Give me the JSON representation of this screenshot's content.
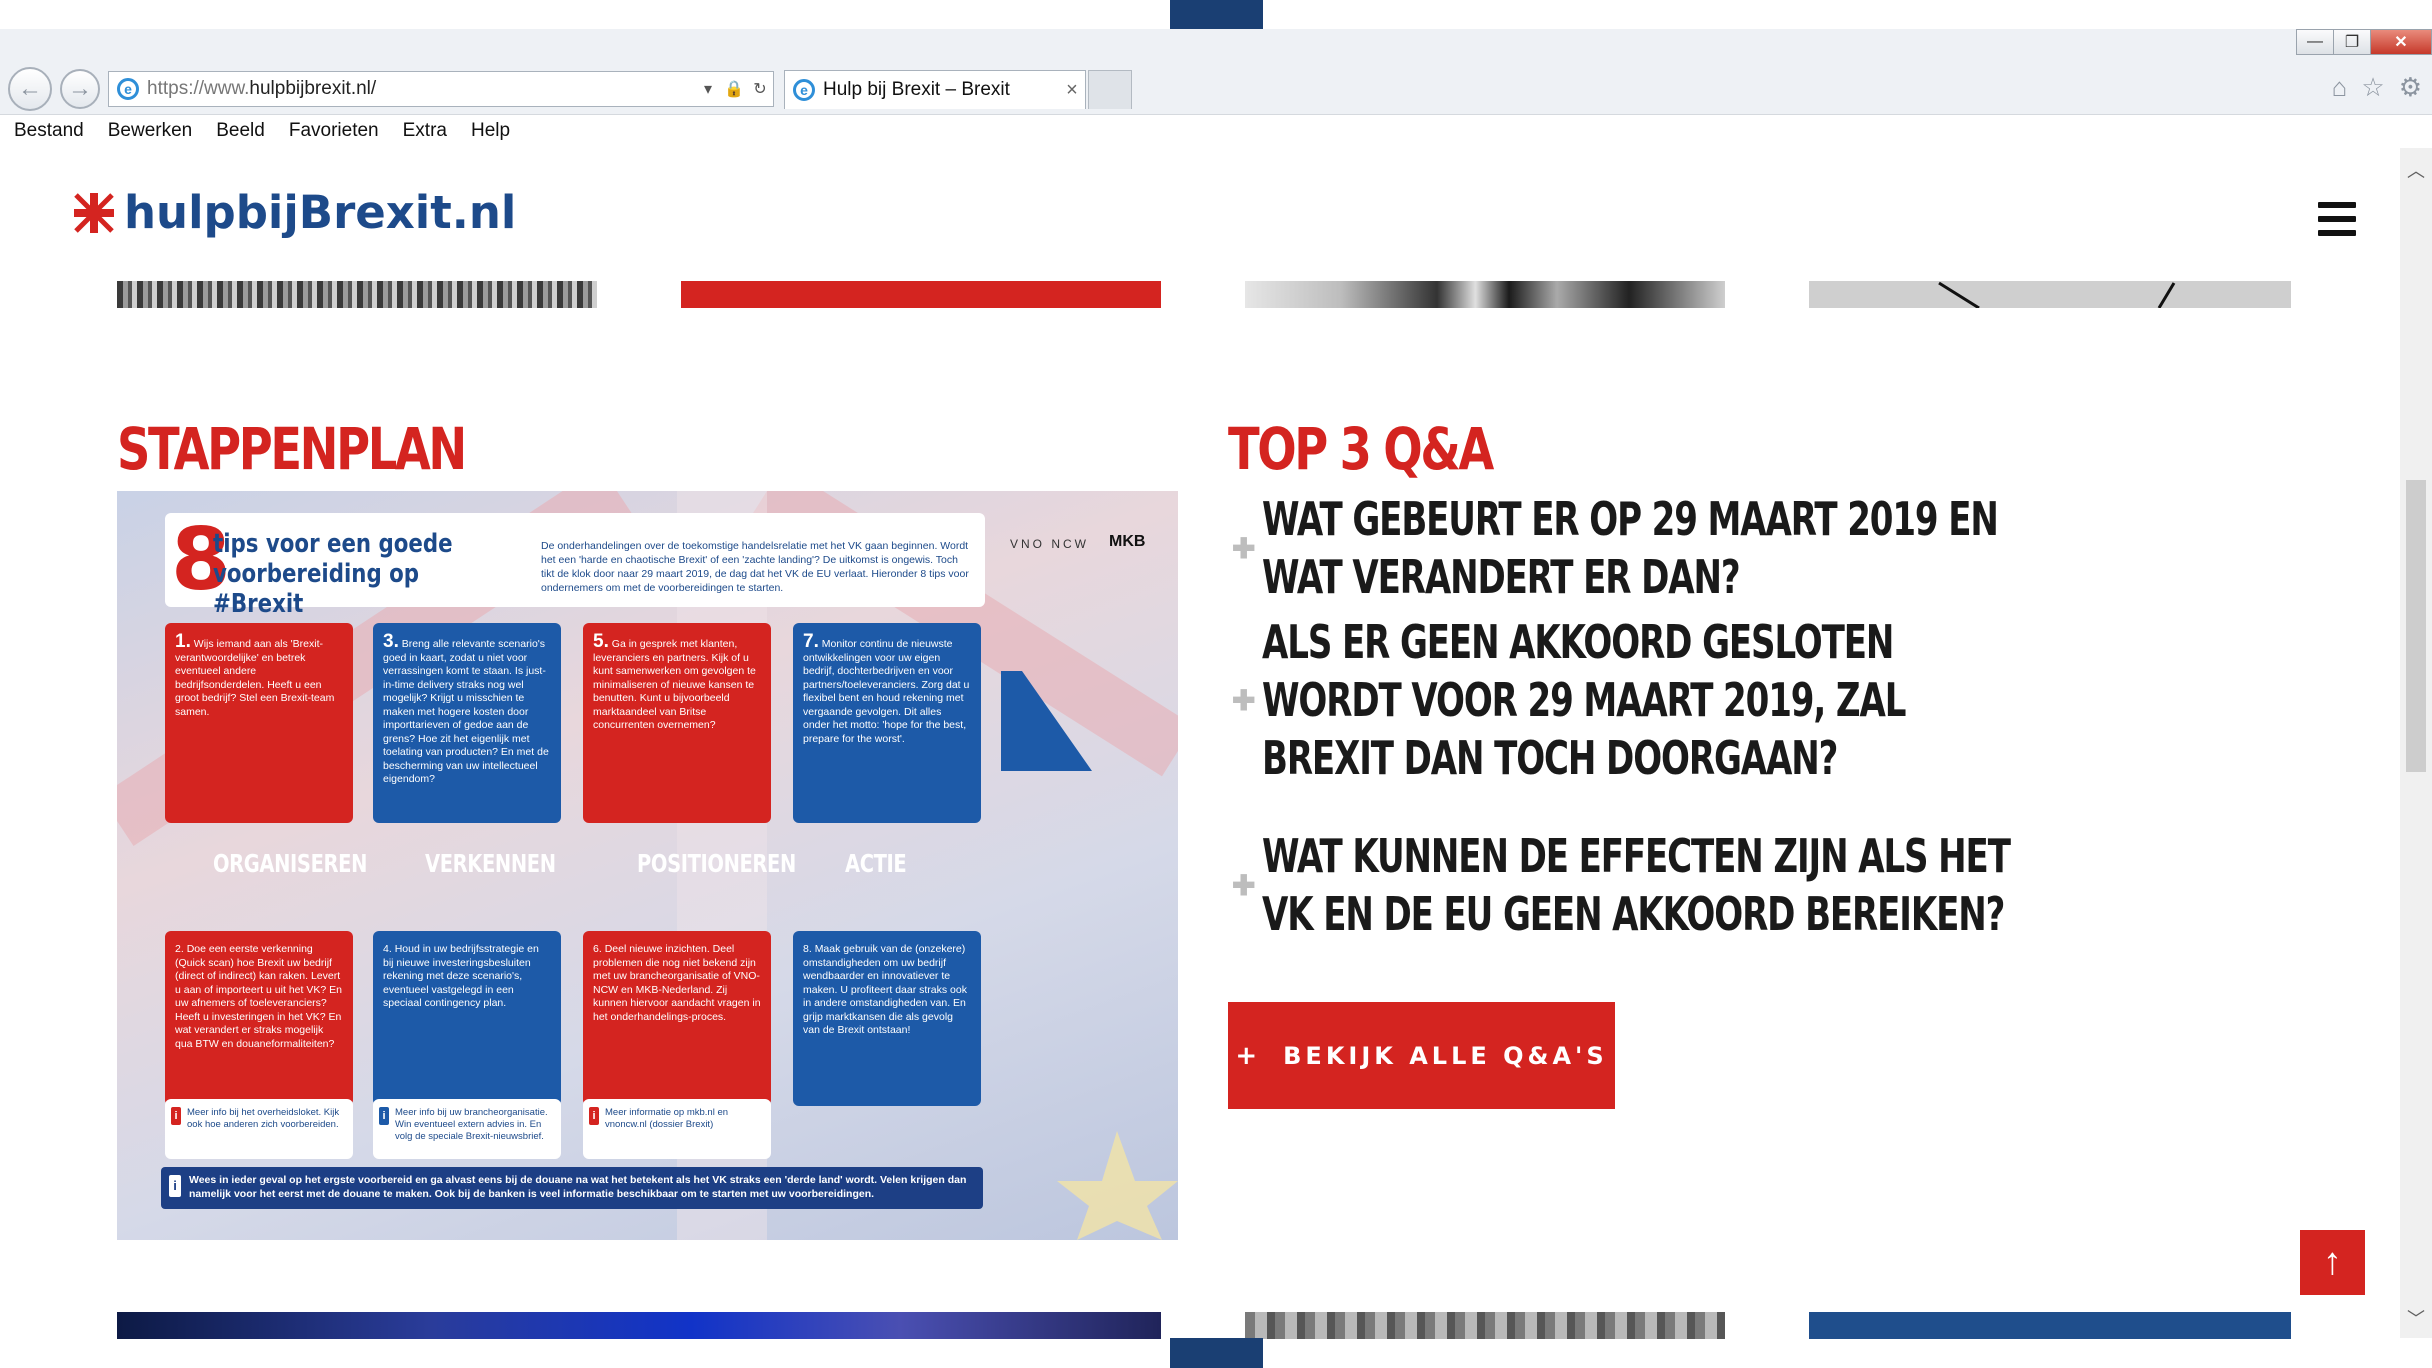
{
  "browser": {
    "url_proto": "https://www.",
    "url_rest": "hulpbijbrexit.nl/",
    "tab_title": "Hulp bij Brexit – Brexit",
    "tab_close": "×",
    "back_glyph": "←",
    "forward_glyph": "→",
    "dropdown_glyph": "▾",
    "lock_glyph": "🔒",
    "refresh_glyph": "↻",
    "home_glyph": "⌂",
    "favorites_glyph": "☆",
    "settings_glyph": "⚙",
    "minimize_glyph": "—",
    "maximize_glyph": "❐",
    "close_glyph": "✕",
    "ie_glyph": "e"
  },
  "menu": {
    "items": [
      "Bestand",
      "Bewerken",
      "Beeld",
      "Favorieten",
      "Extra",
      "Help"
    ]
  },
  "site": {
    "logo_text": "hulpbijBrexit.nl"
  },
  "stappenplan": {
    "heading": "STAPPENPLAN",
    "infographic": {
      "big_number": "8",
      "title": "tips voor een goede voorbereiding op #Brexit",
      "intro": "De onderhandelingen over de toekomstige handelsrelatie met het VK gaan beginnen. Wordt het een 'harde en chaotische Brexit' of een 'zachte landing'? De uitkomst is ongewis. Toch tikt de klok door naar 29 maart 2019, de dag dat het VK de EU verlaat. Hieronder 8 tips voor ondernemers om met de voorbereidingen te starten.",
      "logo_vnoncw": "VNO NCW",
      "logo_mkb": "MKB",
      "top_cards": [
        {
          "num": "1.",
          "text": "Wijs iemand aan als 'Brexit-verantwoordelijke' en betrek eventueel andere bedrijfsonderdelen. Heeft u een groot bedrijf? Stel een Brexit-team samen."
        },
        {
          "num": "3.",
          "text": "Breng alle relevante scenario's goed in kaart, zodat u niet voor verrassingen komt te staan. Is just-in-time delivery straks nog wel mogelijk? Krijgt u misschien te maken met hogere kosten door importtarieven of gedoe aan de grens? Hoe zit het eigenlijk met toelating van producten? En met de bescherming van uw intellectueel eigendom?"
        },
        {
          "num": "5.",
          "text": "Ga in gesprek met klanten, leveranciers en partners. Kijk of u kunt samenwerken om gevolgen te minimaliseren of nieuwe kansen te benutten. Kunt u bijvoorbeeld marktaandeel van Britse concurrenten overnemen?"
        },
        {
          "num": "7.",
          "text": "Monitor continu de nieuwste ontwikkelingen voor uw eigen bedrijf, dochterbedrijven en voor partners/toeleveranciers. Zorg dat u flexibel bent en houd rekening met vergaande gevolgen. Dit alles onder het motto: 'hope for the best, prepare for the worst'."
        }
      ],
      "phases": [
        "ORGANISEREN",
        "VERKENNEN",
        "POSITIONEREN",
        "ACTIE"
      ],
      "bottom_cards": [
        {
          "num": "2.",
          "text": "Doe een eerste verkenning (Quick scan) hoe Brexit uw bedrijf (direct of indirect) kan raken. Levert u aan of importeert u uit het VK? En uw afnemers of toeleveranciers? Heeft u investeringen in het VK? En wat verandert er straks mogelijk qua BTW en douaneformaliteiten?"
        },
        {
          "num": "4.",
          "text": "Houd in uw bedrijfsstrategie en bij nieuwe investeringsbesluiten rekening met deze scenario's, eventueel vastgelegd in een speciaal contingency plan."
        },
        {
          "num": "6.",
          "text": "Deel nieuwe inzichten. Deel problemen die nog niet bekend zijn met uw brancheorganisatie of VNO-NCW en MKB-Nederland. Zij kunnen hiervoor aandacht vragen in het onderhandelings-proces."
        },
        {
          "num": "8.",
          "text": "Maak gebruik van de (onzekere) omstandigheden om uw bedrijf wendbaarder en innovatiever te maken. U profiteert daar straks ook in andere omstandigheden van. En grijp marktkansen die als gevolg van de Brexit ontstaan!"
        }
      ],
      "notes": [
        {
          "text": "Meer info bij het overheidsloket. Kijk ook hoe anderen zich voorbereiden."
        },
        {
          "text": "Meer info bij uw brancheorganisatie. Win eventueel extern advies in. En volg de speciale Brexit-nieuwsbrief."
        },
        {
          "text": "Meer informatie op mkb.nl en vnoncw.nl (dossier Brexit)"
        }
      ],
      "note_icon": "i",
      "footer": "Wees in ieder geval op het ergste voorbereid en ga alvast eens bij de douane na wat het betekent als het VK straks een 'derde land' wordt. Velen krijgen dan namelijk voor het eerst met de douane te maken. Ook bij de banken is veel informatie beschikbaar om te starten met uw voorbereidingen."
    }
  },
  "qa": {
    "heading": "TOP 3 Q&A",
    "plus_glyph": "✚",
    "items": [
      "WAT GEBEURT ER OP 29 MAART 2019 EN WAT VERANDERT ER DAN?",
      "ALS ER GEEN AKKOORD GESLOTEN WORDT VOOR 29 MAART 2019, ZAL BREXIT DAN TOCH DOORGAAN?",
      "WAT KUNNEN DE EFFECTEN ZIJN ALS HET VK EN DE EU GEEN AKKOORD BEREIKEN?"
    ],
    "button_plus": "+",
    "button_label": "BEKIJK ALLE Q&A'S"
  },
  "back_to_top_glyph": "↑",
  "colors": {
    "brand_red": "#d42420",
    "brand_blue": "#1d4a8a",
    "slide_navy": "#1a3f73"
  }
}
